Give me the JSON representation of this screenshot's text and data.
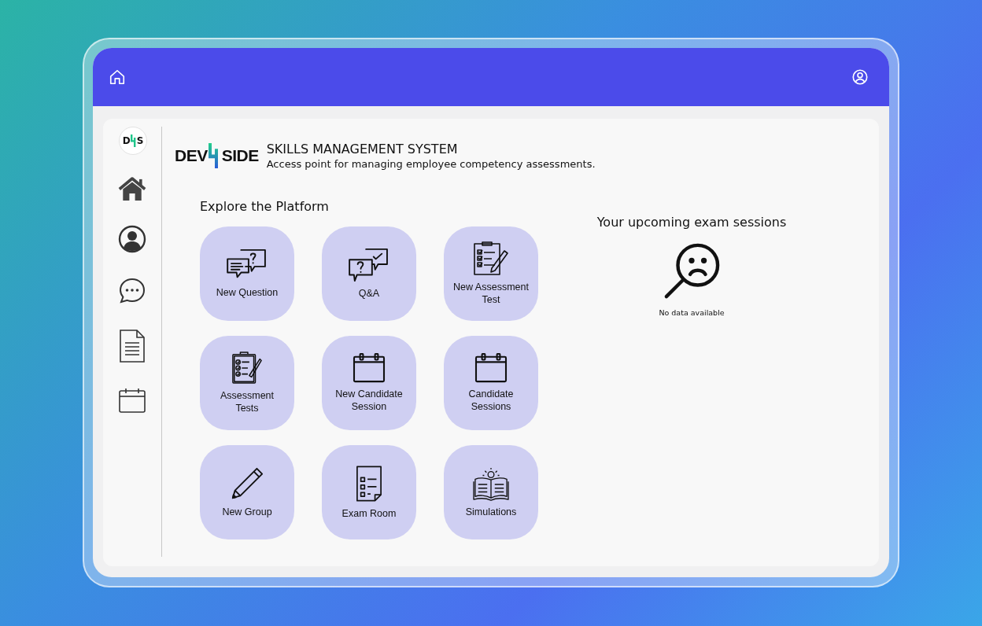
{
  "sidebar": {
    "logo": {
      "left": "D",
      "right": "S"
    }
  },
  "brand": {
    "logo": {
      "left": "DEV",
      "right": "SIDE"
    },
    "title": "SKILLS MANAGEMENT SYSTEM",
    "subtitle": "Access point for managing employee competency assessments."
  },
  "explore": {
    "heading": "Explore the Platform",
    "tiles": [
      {
        "label": "New Question"
      },
      {
        "label": "Q&A"
      },
      {
        "label": "New Assessment Test"
      },
      {
        "label": "Assessment Tests"
      },
      {
        "label": "New Candidate Session"
      },
      {
        "label": "Candidate Sessions"
      },
      {
        "label": "New Group"
      },
      {
        "label": "Exam Room"
      },
      {
        "label": "Simulations"
      }
    ]
  },
  "sessions": {
    "heading": "Your upcoming exam sessions",
    "empty_text": "No data available"
  }
}
